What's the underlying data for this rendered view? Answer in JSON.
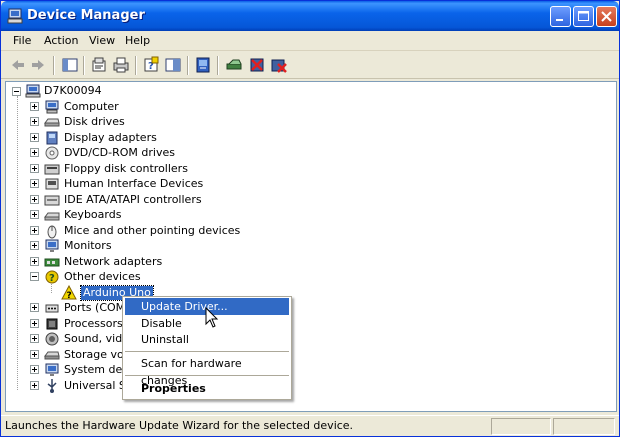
{
  "window": {
    "title": "Device Manager"
  },
  "colors": {
    "titlebar": "#0A64EA",
    "selection": "#316AC5",
    "warning": "#E8C800"
  },
  "menubar": {
    "items": [
      "File",
      "Action",
      "View",
      "Help"
    ]
  },
  "toolbar": {
    "icons": [
      "back-arrow-icon",
      "forward-arrow-icon",
      "console-tree-icon",
      "properties-icon",
      "print-icon",
      "help-icon",
      "view-icon",
      "update-driver-icon",
      "scan-hardware-icon",
      "uninstall-icon",
      "disable-icon"
    ]
  },
  "tree": {
    "root": "D7K00094",
    "nodes": [
      {
        "label": "Computer",
        "icon": "computer-icon"
      },
      {
        "label": "Disk drives",
        "icon": "disk-drive-icon"
      },
      {
        "label": "Display adapters",
        "icon": "display-adapter-icon"
      },
      {
        "label": "DVD/CD-ROM drives",
        "icon": "cdrom-icon"
      },
      {
        "label": "Floppy disk controllers",
        "icon": "floppy-controller-icon"
      },
      {
        "label": "Human Interface Devices",
        "icon": "hid-icon"
      },
      {
        "label": "IDE ATA/ATAPI controllers",
        "icon": "ide-controller-icon"
      },
      {
        "label": "Keyboards",
        "icon": "keyboard-icon"
      },
      {
        "label": "Mice and other pointing devices",
        "icon": "mouse-icon"
      },
      {
        "label": "Monitors",
        "icon": "monitor-icon"
      },
      {
        "label": "Network adapters",
        "icon": "network-adapter-icon"
      },
      {
        "label": "Other devices",
        "icon": "unknown-device-icon"
      },
      {
        "label": "Arduino Uno",
        "icon": "warning-device-icon"
      },
      {
        "label": "Ports (COM &",
        "icon": "port-icon"
      },
      {
        "label": "Processors",
        "icon": "processor-icon"
      },
      {
        "label": "Sound, video",
        "icon": "sound-icon"
      },
      {
        "label": "Storage volu",
        "icon": "storage-icon"
      },
      {
        "label": "System devic",
        "icon": "system-device-icon"
      },
      {
        "label": "Universal Ser",
        "icon": "usb-icon"
      }
    ]
  },
  "context_menu": {
    "update_driver": "Update Driver...",
    "disable": "Disable",
    "uninstall": "Uninstall",
    "scan": "Scan for hardware changes",
    "properties": "Properties"
  },
  "statusbar": {
    "text": "Launches the Hardware Update Wizard for the selected device."
  }
}
